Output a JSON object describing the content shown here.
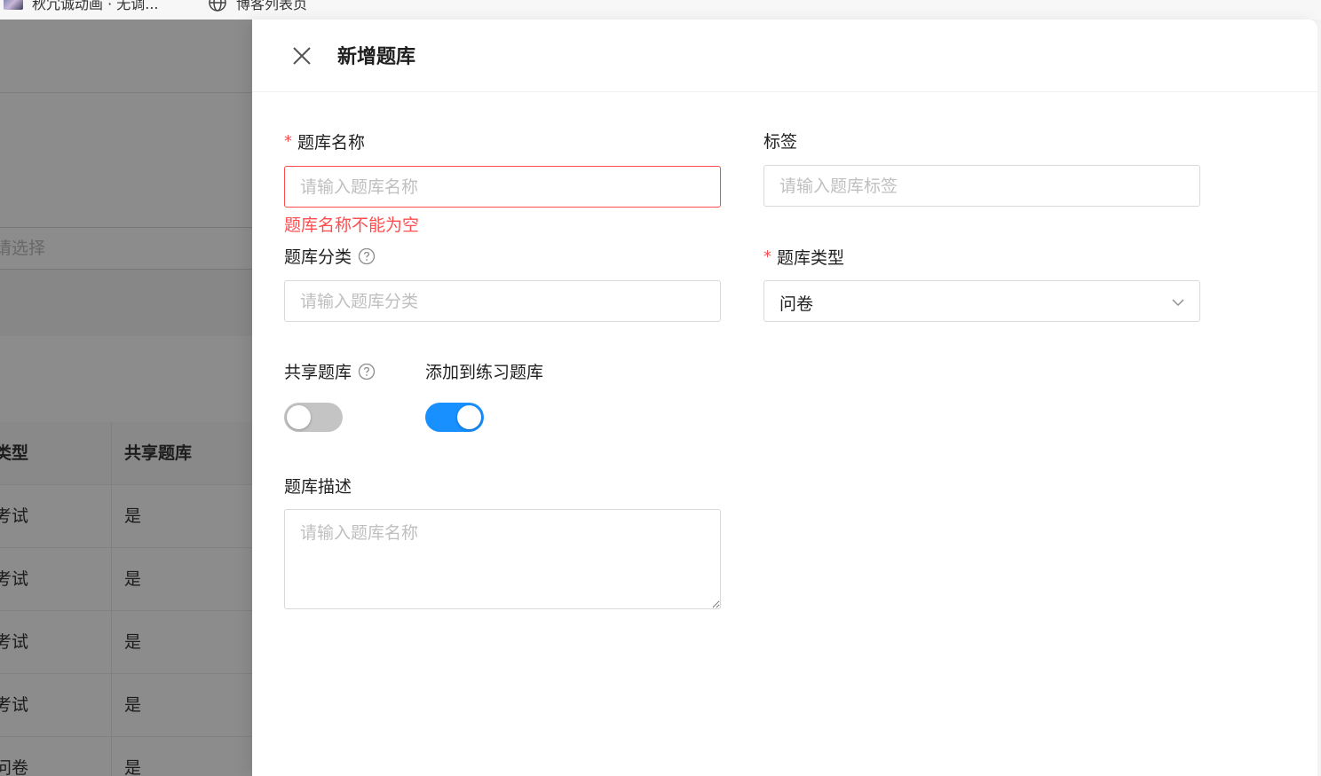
{
  "bookmarks": [
    {
      "label": "秋冗诚动画 · 无调..."
    },
    {
      "label": "博客列表页"
    }
  ],
  "background_page": {
    "select_placeholder": "请选择",
    "table": {
      "headers": [
        "类型",
        "共享题库"
      ],
      "rows": [
        [
          "考试",
          "是"
        ],
        [
          "考试",
          "是"
        ],
        [
          "考试",
          "是"
        ],
        [
          "考试",
          "是"
        ],
        [
          "问卷",
          "是"
        ]
      ]
    }
  },
  "drawer": {
    "title": "新增题库",
    "fields": {
      "name": {
        "label": "题库名称",
        "required_mark": "*",
        "placeholder": "请输入题库名称",
        "error": "题库名称不能为空"
      },
      "tags": {
        "label": "标签",
        "placeholder": "请输入题库标签"
      },
      "category": {
        "label": "题库分类",
        "placeholder": "请输入题库分类"
      },
      "type": {
        "label": "题库类型",
        "required_mark": "*",
        "value": "问卷"
      },
      "share": {
        "label": "共享题库",
        "checked": false
      },
      "practice": {
        "label": "添加到练习题库",
        "checked": true
      },
      "description": {
        "label": "题库描述",
        "placeholder": "请输入题库名称"
      }
    }
  },
  "colors": {
    "primary": "#1890ff",
    "error": "#ff4d4f",
    "switch_off": "#c4c4c4"
  }
}
